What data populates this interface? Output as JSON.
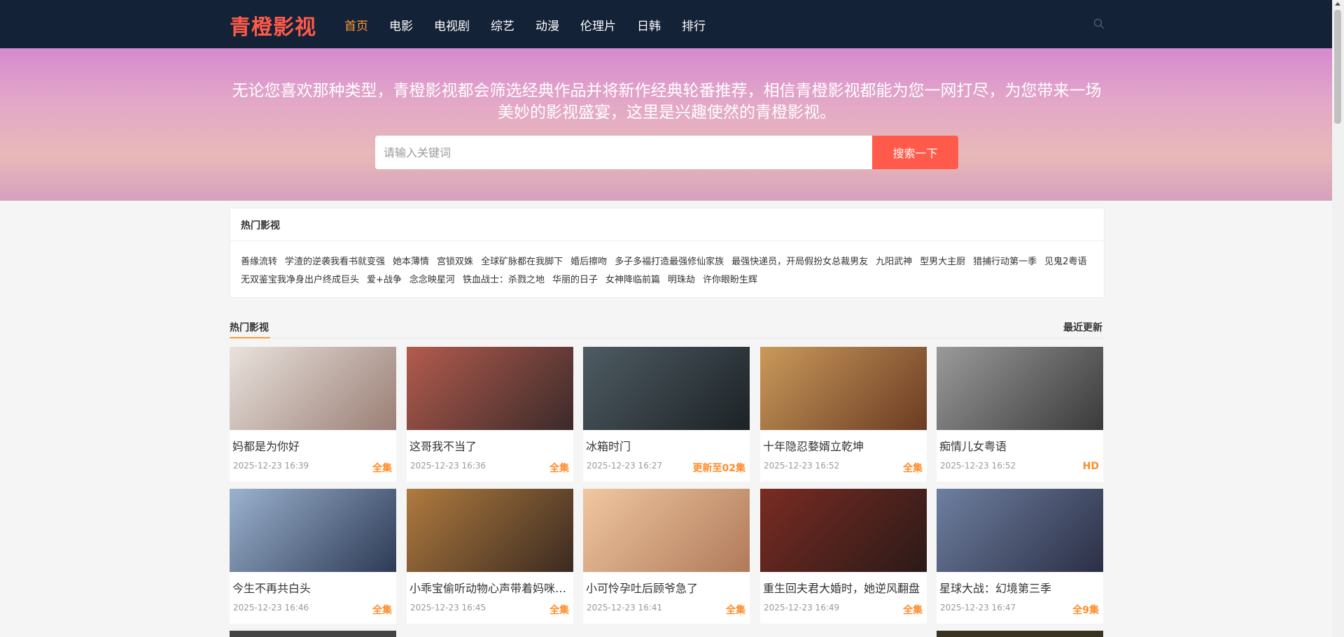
{
  "header": {
    "logo": "青橙影视",
    "nav": [
      "首页",
      "电影",
      "电视剧",
      "综艺",
      "动漫",
      "伦理片",
      "日韩",
      "排行"
    ],
    "active_index": 0
  },
  "hero": {
    "text": "无论您喜欢那种类型，青橙影视都会筛选经典作品并将新作经典轮番推荐，相信青橙影视都能为您一网打尽，为您带来一场美妙的影视盛宴，这里是兴趣使然的青橙影视。",
    "search_placeholder": "请输入关键词",
    "search_button": "搜索一下"
  },
  "hot_panel": {
    "title": "热门影视",
    "tags": [
      "善缘流转",
      "学渣的逆袭我看书就变强",
      "她本薄情",
      "宫锁双姝",
      "全球矿脉都在我脚下",
      "婚后擦吻",
      "多子多福打造最强修仙家族",
      "最强快递员，开局假扮女总裁男友",
      "九阳武神",
      "型男大主厨",
      "猎捕行动第一季",
      "见鬼2粤语",
      "无双鉴宝我净身出户终成巨头",
      "爱+战争",
      "念念映星河",
      "铁血战士：杀戮之地",
      "华丽的日子",
      "女神降临前篇",
      "明珠劫",
      "许你眼盼生辉"
    ]
  },
  "section": {
    "title": "热门影视",
    "right_link": "最近更新"
  },
  "cards": [
    {
      "title": "妈都是为你好",
      "date": "2025-12-23 16:39",
      "status": "全集",
      "colors": [
        "#e9e2dd",
        "#9a7f75"
      ]
    },
    {
      "title": "这哥我不当了",
      "date": "2025-12-23 16:36",
      "status": "全集",
      "colors": [
        "#b35b4d",
        "#3b2a2a"
      ]
    },
    {
      "title": "冰箱时门",
      "date": "2025-12-23 16:27",
      "status": "更新至02集",
      "colors": [
        "#4e5c63",
        "#1c2226"
      ]
    },
    {
      "title": "十年隐忍婺婿立乾坤",
      "date": "2025-12-23 16:52",
      "status": "全集",
      "colors": [
        "#c99a5a",
        "#6b3b23"
      ]
    },
    {
      "title": "痴情儿女粤语",
      "date": "2025-12-23 16:52",
      "status": "HD",
      "colors": [
        "#9a9a9a",
        "#3a3a3a"
      ]
    },
    {
      "title": "今生不再共白头",
      "date": "2025-12-23 16:46",
      "status": "全集",
      "colors": [
        "#9bb2cf",
        "#2d3a55"
      ]
    },
    {
      "title": "小乖宝偷听动物心声带着妈咪成为大女主",
      "date": "2025-12-23 16:45",
      "status": "全集",
      "colors": [
        "#b07b3f",
        "#3a2a20"
      ]
    },
    {
      "title": "小可怜孕吐后顾爷急了",
      "date": "2025-12-23 16:41",
      "status": "全集",
      "colors": [
        "#f0c7a0",
        "#b07a5a"
      ]
    },
    {
      "title": "重生回夫君大婚时，她逆风翻盘",
      "date": "2025-12-23 16:49",
      "status": "全集",
      "colors": [
        "#7a2b22",
        "#2a1a18"
      ]
    },
    {
      "title": "星球大战：幻境第三季",
      "date": "2025-12-23 16:47",
      "status": "全9集",
      "colors": [
        "#6e7fa0",
        "#2b2f45"
      ]
    }
  ]
}
